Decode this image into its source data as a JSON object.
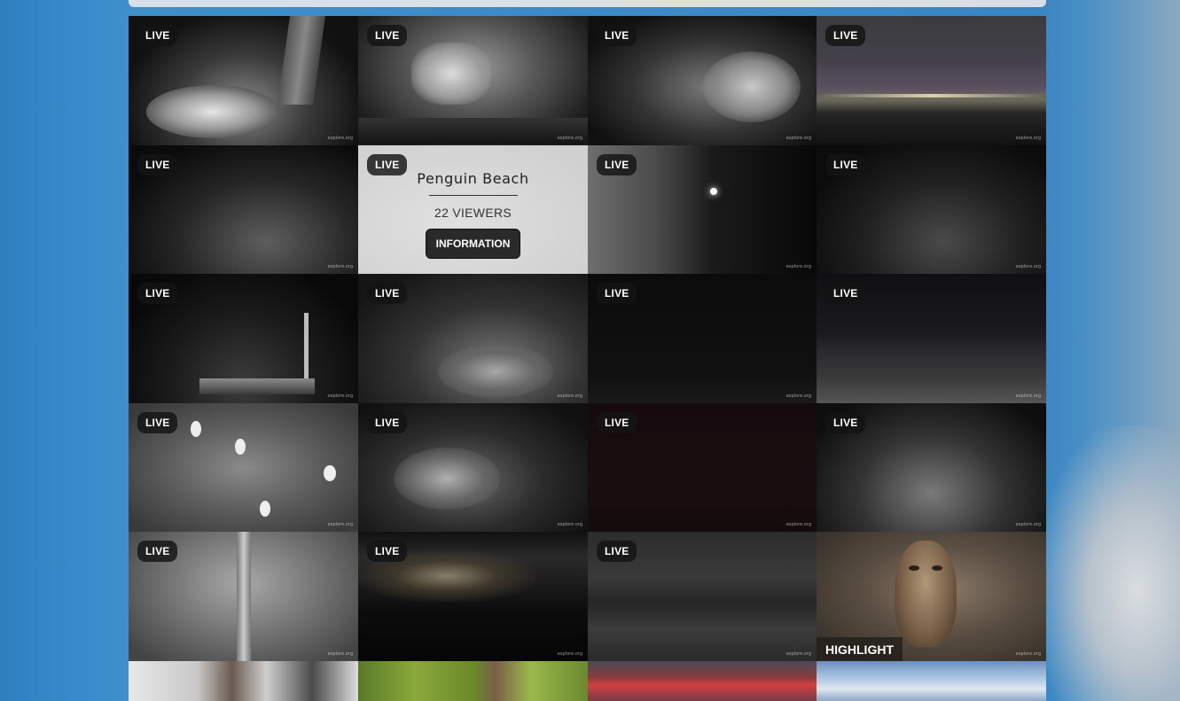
{
  "header": {},
  "live_label": "LIVE",
  "watermark": "explore.org",
  "tiles": [
    {
      "name": "nest-snow-tree",
      "status": "LIVE"
    },
    {
      "name": "banana-feeder",
      "status": "LIVE"
    },
    {
      "name": "nest-branches-night",
      "status": "LIVE"
    },
    {
      "name": "night-sky-horizon",
      "status": "LIVE"
    },
    {
      "name": "nest-mound-dark",
      "status": "LIVE"
    },
    {
      "name": "penguin-beach",
      "status": "LIVE",
      "title": "Penguin Beach",
      "viewers": "22 VIEWERS",
      "button": "INFORMATION"
    },
    {
      "name": "cliff-night",
      "status": "LIVE"
    },
    {
      "name": "nest-dark-2",
      "status": "LIVE"
    },
    {
      "name": "platform-pole",
      "status": "LIVE"
    },
    {
      "name": "nest-dead-tree",
      "status": "LIVE"
    },
    {
      "name": "dark-feed",
      "status": "LIVE"
    },
    {
      "name": "dunes-night",
      "status": "LIVE"
    },
    {
      "name": "egrets-tree",
      "status": "LIVE"
    },
    {
      "name": "nest-rocks",
      "status": "LIVE"
    },
    {
      "name": "dark-red-feed",
      "status": "LIVE"
    },
    {
      "name": "shrub-nest",
      "status": "LIVE"
    },
    {
      "name": "forest-night",
      "status": "LIVE"
    },
    {
      "name": "coast-lights",
      "status": "LIVE"
    },
    {
      "name": "grey-water",
      "status": "LIVE"
    },
    {
      "name": "long-eared-owl",
      "status": "HIGHLIGHT"
    },
    {
      "name": "squirrel-cam",
      "status": ""
    },
    {
      "name": "forest-day",
      "status": ""
    },
    {
      "name": "sunset",
      "status": ""
    },
    {
      "name": "blue-sky",
      "status": ""
    }
  ],
  "highlight_label": "HIGHLIGHT"
}
